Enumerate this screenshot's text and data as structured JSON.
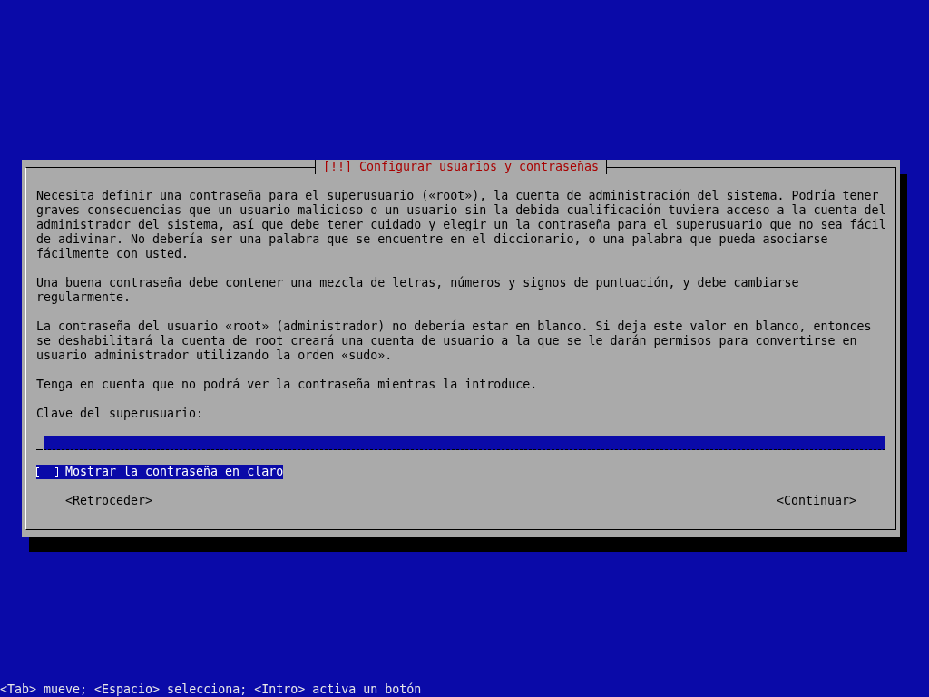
{
  "dialog": {
    "title": "[!!] Configurar usuarios y contraseñas",
    "paragraphs": [
      "Necesita definir una contraseña para el superusuario («root»), la cuenta de administración del sistema. Podría tener graves consecuencias que un usuario malicioso o un usuario sin la debida cualificación tuviera acceso a la cuenta del administrador del sistema, así que debe tener cuidado y elegir un la contraseña para el superusuario que no sea fácil de adivinar. No debería ser una palabra que se encuentre en el diccionario, o una palabra que pueda asociarse fácilmente con usted.",
      "Una buena contraseña debe contener una mezcla de letras, números y signos de puntuación, y debe cambiarse regularmente.",
      "La contraseña del usuario «root» (administrador) no debería estar en blanco. Si deja este valor en blanco, entonces se deshabilitará la cuenta de root creará una cuenta de usuario a la que se le darán permisos para convertirse en usuario administrador utilizando la orden «sudo».",
      "Tenga en cuenta que no podrá ver la contraseña mientras la introduce."
    ],
    "field_label": "Clave del superusuario:",
    "password_field": {
      "focused": false
    },
    "checkbox": {
      "label": "Mostrar la contraseña en claro",
      "checked": false,
      "focused": true
    },
    "buttons": [
      {
        "label": "<Retroceder>",
        "selected": false
      },
      {
        "label": "<Continuar>",
        "selected": false
      }
    ]
  },
  "status_bar": "<Tab> mueve; <Espacio> selecciona; <Intro> activa un botón"
}
